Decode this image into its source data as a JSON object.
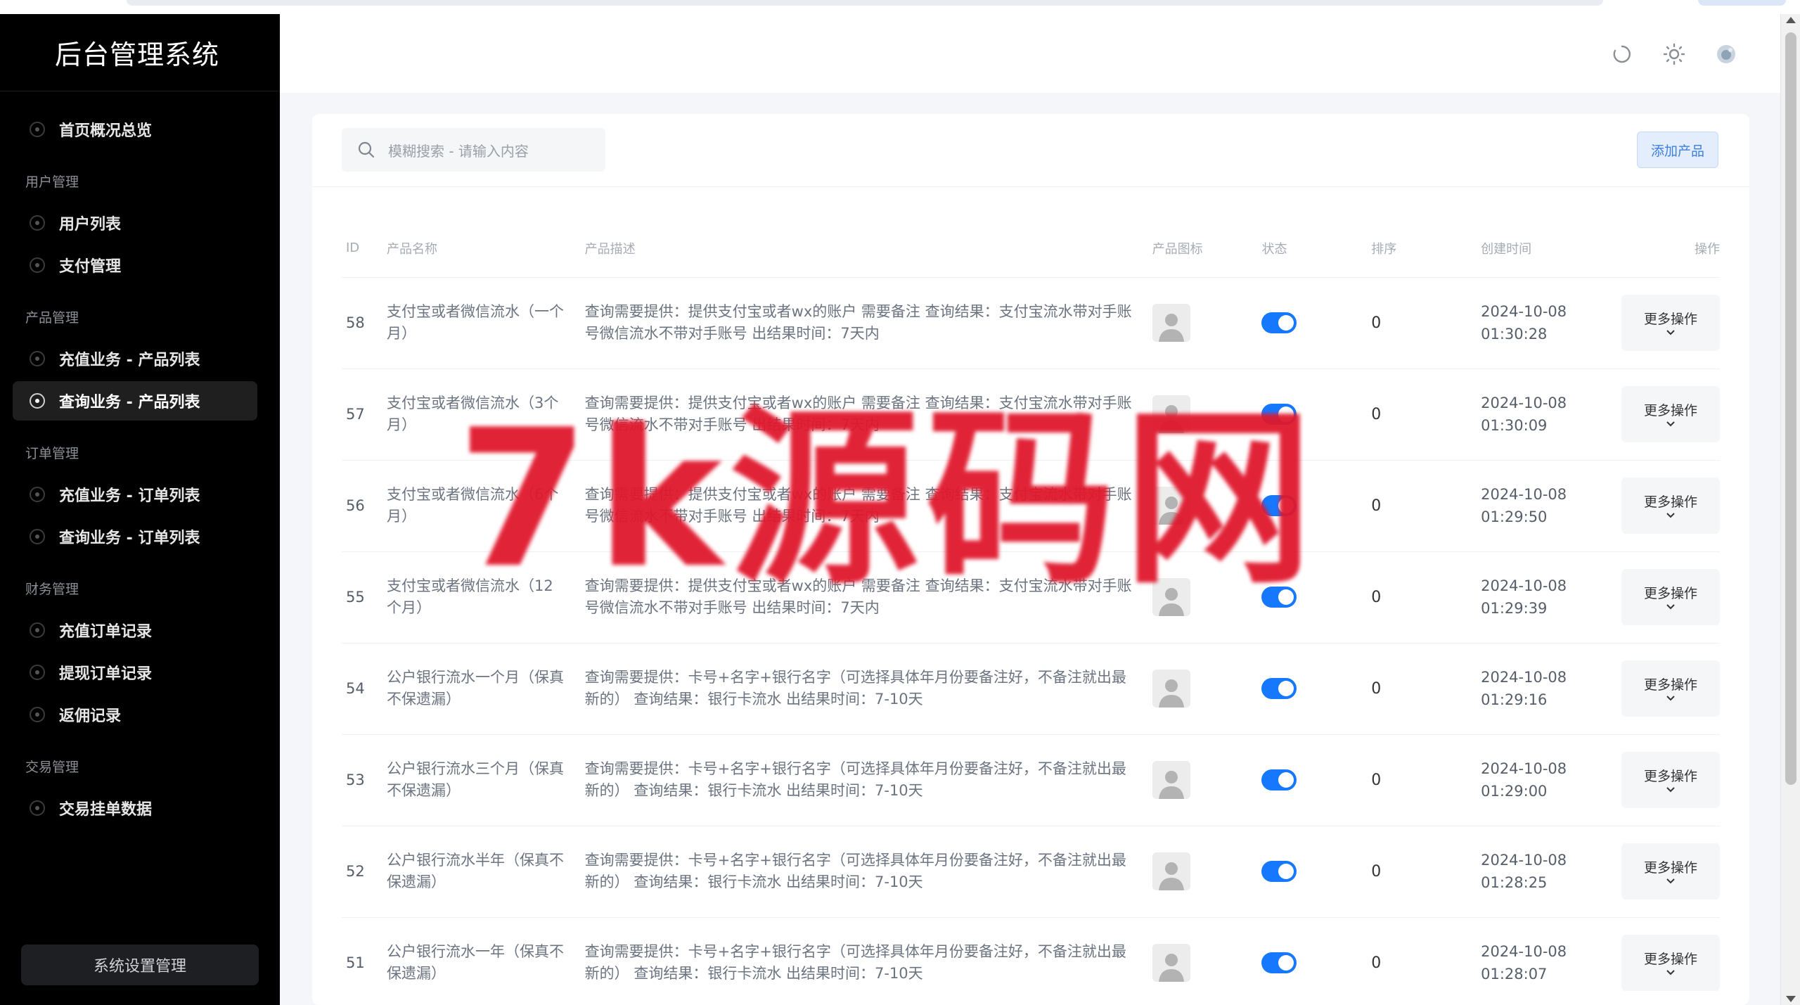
{
  "app": {
    "title": "后台管理系统"
  },
  "sidebar": {
    "items": [
      {
        "type": "item",
        "label": "首页概况总览",
        "active": false
      },
      {
        "type": "group",
        "label": "用户管理"
      },
      {
        "type": "item",
        "label": "用户列表",
        "active": false
      },
      {
        "type": "item",
        "label": "支付管理",
        "active": false
      },
      {
        "type": "group",
        "label": "产品管理"
      },
      {
        "type": "item",
        "label": "充值业务 - 产品列表",
        "active": false
      },
      {
        "type": "item",
        "label": "查询业务 - 产品列表",
        "active": true
      },
      {
        "type": "group",
        "label": "订单管理"
      },
      {
        "type": "item",
        "label": "充值业务 - 订单列表",
        "active": false
      },
      {
        "type": "item",
        "label": "查询业务 - 订单列表",
        "active": false
      },
      {
        "type": "group",
        "label": "财务管理"
      },
      {
        "type": "item",
        "label": "充值订单记录",
        "active": false
      },
      {
        "type": "item",
        "label": "提现订单记录",
        "active": false
      },
      {
        "type": "item",
        "label": "返佣记录",
        "active": false
      },
      {
        "type": "group",
        "label": "交易管理"
      },
      {
        "type": "item",
        "label": "交易挂单数据",
        "active": false
      }
    ],
    "footer_button": "系统设置管理"
  },
  "header": {
    "icons": [
      "refresh-icon",
      "sun-icon",
      "avatar-icon"
    ]
  },
  "toolbar": {
    "search_placeholder": "模糊搜索 - 请输入内容",
    "add_button": "添加产品"
  },
  "table": {
    "headers": {
      "id": "ID",
      "name": "产品名称",
      "desc": "产品描述",
      "icon": "产品图标",
      "status": "状态",
      "sort": "排序",
      "created": "创建时间",
      "op": "操作"
    },
    "rows": [
      {
        "id": "58",
        "name": "支付宝或者微信流水（一个月）",
        "desc": "查询需要提供：提供支付宝或者wx的账户 需要备注 查询结果：支付宝流水带对手账号微信流水不带对手账号 出结果时间：7天内",
        "status": true,
        "sort": "0",
        "date": "2024-10-08",
        "time": "01:30:28",
        "op": "更多操作"
      },
      {
        "id": "57",
        "name": "支付宝或者微信流水（3个月）",
        "desc": "查询需要提供：提供支付宝或者wx的账户 需要备注 查询结果：支付宝流水带对手账号微信流水不带对手账号 出结果时间：7天内",
        "status": true,
        "sort": "0",
        "date": "2024-10-08",
        "time": "01:30:09",
        "op": "更多操作"
      },
      {
        "id": "56",
        "name": "支付宝或者微信流水（6个月）",
        "desc": "查询需要提供：提供支付宝或者wx的账户 需要备注 查询结果：支付宝流水带对手账号微信流水不带对手账号 出结果时间：7天内",
        "status": true,
        "sort": "0",
        "date": "2024-10-08",
        "time": "01:29:50",
        "op": "更多操作"
      },
      {
        "id": "55",
        "name": "支付宝或者微信流水（12个月）",
        "desc": "查询需要提供：提供支付宝或者wx的账户 需要备注 查询结果：支付宝流水带对手账号微信流水不带对手账号 出结果时间：7天内",
        "status": true,
        "sort": "0",
        "date": "2024-10-08",
        "time": "01:29:39",
        "op": "更多操作"
      },
      {
        "id": "54",
        "name": "公户银行流水一个月（保真不保遗漏）",
        "desc": "查询需要提供：卡号+名字+银行名字（可选择具体年月份要备注好，不备注就出最新的） 查询结果：银行卡流水 出结果时间：7-10天",
        "status": true,
        "sort": "0",
        "date": "2024-10-08",
        "time": "01:29:16",
        "op": "更多操作"
      },
      {
        "id": "53",
        "name": "公户银行流水三个月（保真不保遗漏）",
        "desc": "查询需要提供：卡号+名字+银行名字（可选择具体年月份要备注好，不备注就出最新的） 查询结果：银行卡流水 出结果时间：7-10天",
        "status": true,
        "sort": "0",
        "date": "2024-10-08",
        "time": "01:29:00",
        "op": "更多操作"
      },
      {
        "id": "52",
        "name": "公户银行流水半年（保真不保遗漏）",
        "desc": "查询需要提供：卡号+名字+银行名字（可选择具体年月份要备注好，不备注就出最新的） 查询结果：银行卡流水 出结果时间：7-10天",
        "status": true,
        "sort": "0",
        "date": "2024-10-08",
        "time": "01:28:25",
        "op": "更多操作"
      },
      {
        "id": "51",
        "name": "公户银行流水一年（保真不保遗漏）",
        "desc": "查询需要提供：卡号+名字+银行名字（可选择具体年月份要备注好，不备注就出最新的） 查询结果：银行卡流水 出结果时间：7-10天",
        "status": true,
        "sort": "0",
        "date": "2024-10-08",
        "time": "01:28:07",
        "op": "更多操作"
      }
    ]
  },
  "watermark": {
    "text": "7k源码网"
  },
  "colors": {
    "accent": "#1677ff",
    "sidebar_bg": "#000000",
    "watermark": "#e0182d"
  }
}
